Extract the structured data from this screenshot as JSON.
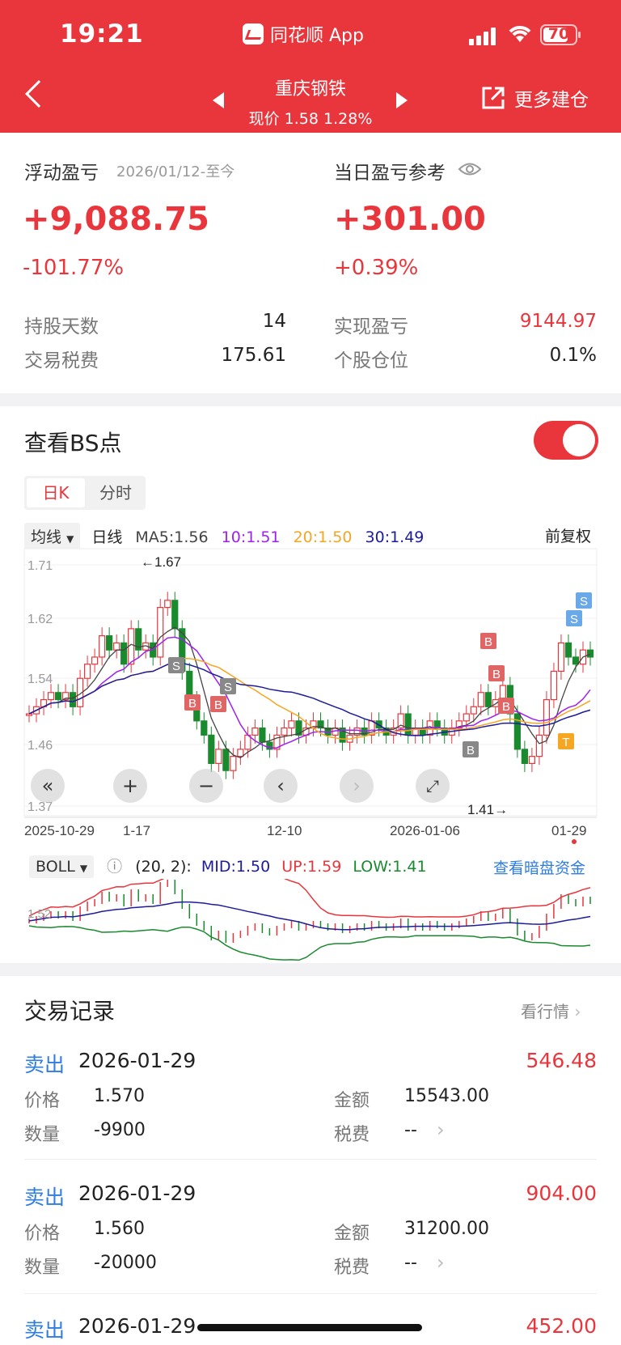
{
  "status_bar": {
    "time": "19:21",
    "app_name": "同花顺 App",
    "battery": "70"
  },
  "header": {
    "title": "重庆钢铁",
    "subtitle": "现价 1.58 1.28%",
    "more_label": "更多建仓"
  },
  "summary": {
    "floating_label": "浮动盈亏",
    "floating_period": "2026/01/12-至今",
    "floating_value": "+9,088.75",
    "floating_pct": "-101.77%",
    "daily_label": "当日盈亏参考",
    "daily_value": "+301.00",
    "daily_pct": "+0.39%",
    "stats": [
      {
        "label": "持股天数",
        "value": "14"
      },
      {
        "label": "交易税费",
        "value": "175.61"
      },
      {
        "label": "实现盈亏",
        "value": "9144.97"
      },
      {
        "label": "个股仓位",
        "value": "0.1%"
      }
    ]
  },
  "bs": {
    "title": "查看BS点",
    "tab_k": "日K",
    "tab_time": "分时"
  },
  "chart_bar": {
    "ma_select": "均线",
    "period": "日线",
    "ma5": "MA5:1.56",
    "ma10": "10:1.51",
    "ma20": "20:1.50",
    "ma30": "30:1.49",
    "adjust": "前复权"
  },
  "kline": {
    "y_ticks": [
      "1.71",
      "1.62",
      "1.54",
      "1.46",
      "1.37"
    ],
    "high_label": "←1.67",
    "low_label": "1.41→",
    "x_labels": [
      "2025-10-29",
      "1-17",
      "12-10",
      "2026-01-06",
      "01-29"
    ]
  },
  "boll": {
    "select": "BOLL",
    "params": "(20, 2):",
    "mid": "MID:1.50",
    "up": "UP:1.59",
    "low": "LOW:1.41",
    "link": "查看暗盘资金",
    "y_tick": "1.52"
  },
  "records": {
    "title": "交易记录",
    "link": "看行情",
    "price_label": "价格",
    "qty_label": "数量",
    "amount_label": "金额",
    "fee_label": "税费",
    "items": [
      {
        "type": "卖出",
        "date": "2026-01-29",
        "pnl": "546.48",
        "price": "1.570",
        "qty": "-9900",
        "amount": "15543.00",
        "fee": "--"
      },
      {
        "type": "卖出",
        "date": "2026-01-29",
        "pnl": "904.00",
        "price": "1.560",
        "qty": "-20000",
        "amount": "31200.00",
        "fee": "--"
      },
      {
        "type": "卖出",
        "date": "2026-01-29",
        "pnl": "452.00"
      }
    ]
  },
  "colors": {
    "brand_red": "#e9363d",
    "up": "#e9363d",
    "down": "#1a8a2e",
    "ma5": "#444444",
    "ma10": "#a020f0",
    "ma20": "#f5a623",
    "ma30": "#1c1c9c",
    "link_blue": "#2f7de1"
  }
}
